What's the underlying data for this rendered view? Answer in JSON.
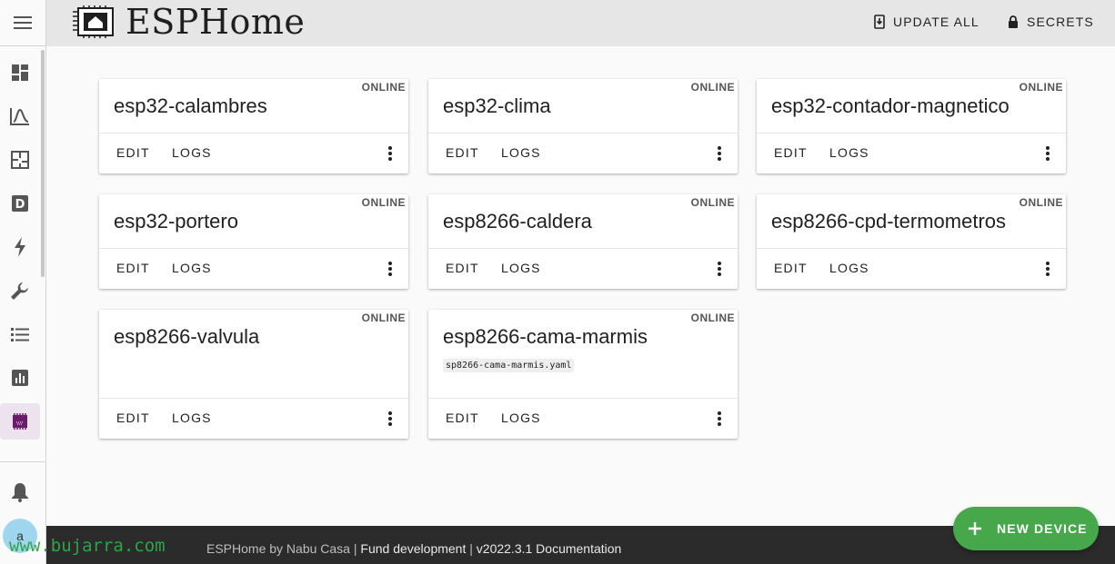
{
  "app": {
    "title": "ESPHome"
  },
  "header": {
    "update_all": "UPDATE ALL",
    "secrets": "SECRETS"
  },
  "sidebar": {
    "items": [
      {
        "icon": "dashboard-icon"
      },
      {
        "icon": "chart-icon"
      },
      {
        "icon": "floorplan-icon"
      },
      {
        "icon": "d-icon"
      },
      {
        "icon": "lightning-icon"
      },
      {
        "icon": "wrench-icon"
      },
      {
        "icon": "list-icon"
      },
      {
        "icon": "bar-chart-icon"
      },
      {
        "icon": "chip-icon",
        "active": true
      }
    ],
    "avatar_initial": "a"
  },
  "devices": [
    {
      "name": "esp32-calambres",
      "status": "ONLINE",
      "edit": "EDIT",
      "logs": "LOGS"
    },
    {
      "name": "esp32-clima",
      "status": "ONLINE",
      "edit": "EDIT",
      "logs": "LOGS"
    },
    {
      "name": "esp32-contador-magnetico",
      "status": "ONLINE",
      "edit": "EDIT",
      "logs": "LOGS"
    },
    {
      "name": "esp32-portero",
      "status": "ONLINE",
      "edit": "EDIT",
      "logs": "LOGS"
    },
    {
      "name": "esp8266-caldera",
      "status": "ONLINE",
      "edit": "EDIT",
      "logs": "LOGS"
    },
    {
      "name": "esp8266-cpd-termometros",
      "status": "ONLINE",
      "edit": "EDIT",
      "logs": "LOGS"
    },
    {
      "name": "esp8266-valvula",
      "status": "ONLINE",
      "edit": "EDIT",
      "logs": "LOGS"
    },
    {
      "name": "esp8266-cama-marmis",
      "status": "ONLINE",
      "file": "sp8266-cama-marmis.yaml",
      "edit": "EDIT",
      "logs": "LOGS"
    }
  ],
  "fab": {
    "label": "NEW DEVICE"
  },
  "footer": {
    "by": "ESPHome by Nabu Casa",
    "sep1": " | ",
    "fund": "Fund development",
    "sep2": " | ",
    "version": "v2022.3.1",
    "docs": "Documentation"
  },
  "watermark": "www.bujarra.com",
  "colors": {
    "accent": "#46a74b",
    "footer_bg": "#2b2b2b",
    "header_bg": "#e6e6e6",
    "active_item": "#ede3ee"
  }
}
